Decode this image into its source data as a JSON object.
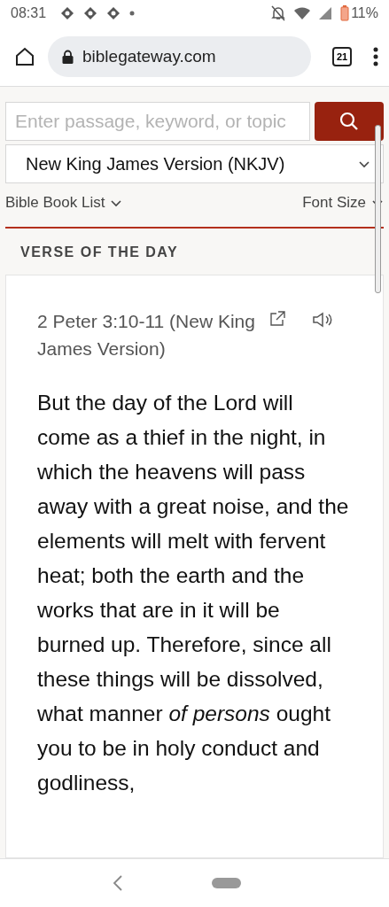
{
  "status_bar": {
    "time": "08:31",
    "battery": "11%"
  },
  "browser": {
    "url": "biblegateway.com",
    "tab_count": "21"
  },
  "search": {
    "placeholder": "Enter passage, keyword, or topic"
  },
  "version_select": {
    "value": "New King James Version (NKJV)"
  },
  "links": [
    {
      "label": "Bible Book List"
    },
    {
      "label": "Font Size"
    }
  ],
  "section_title": "VERSE OF THE DAY",
  "verse": {
    "reference": "2 Peter 3:10-11 (New King James Version)",
    "text": "But the day of the Lord will come as a thief in the night, in which the heavens will pass away with a great noise, and the elements will melt with fervent heat; both the earth and the works that are in it will be burned up. Therefore, since all these things will be dissolved, what manner *of persons* ought you to be in holy conduct and godliness,"
  }
}
